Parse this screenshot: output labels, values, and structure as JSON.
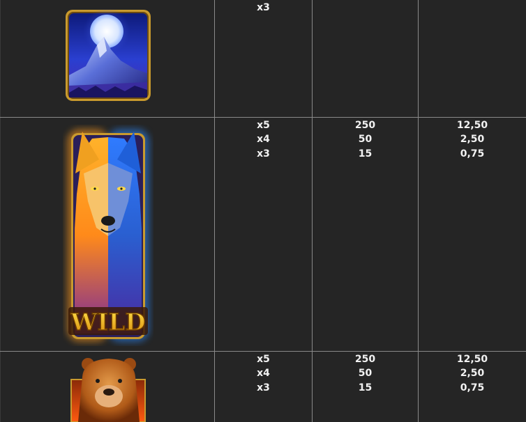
{
  "paytable": {
    "rows": [
      {
        "symbol_icon": "mountain-moon-icon",
        "multipliers": [
          "x3",
          "",
          ""
        ],
        "column_a": [
          "",
          "",
          ""
        ],
        "column_b": [
          "",
          "",
          ""
        ]
      },
      {
        "symbol_icon": "wild-wolf-icon",
        "symbol_label": "WILD",
        "multipliers": [
          "x5",
          "x4",
          "x3"
        ],
        "column_a": [
          "250",
          "50",
          "15"
        ],
        "column_b": [
          "12,50",
          "2,50",
          "0,75"
        ]
      },
      {
        "symbol_icon": "bear-icon",
        "multipliers": [
          "x5",
          "x4",
          "x3"
        ],
        "column_a": [
          "250",
          "50",
          "15"
        ],
        "column_b": [
          "12,50",
          "2,50",
          "0,75"
        ]
      }
    ]
  },
  "colors": {
    "background": "#252525",
    "grid_line": "#8a8a8a",
    "text": "#f2f2f2",
    "frame_gold": "#c99a2e"
  }
}
